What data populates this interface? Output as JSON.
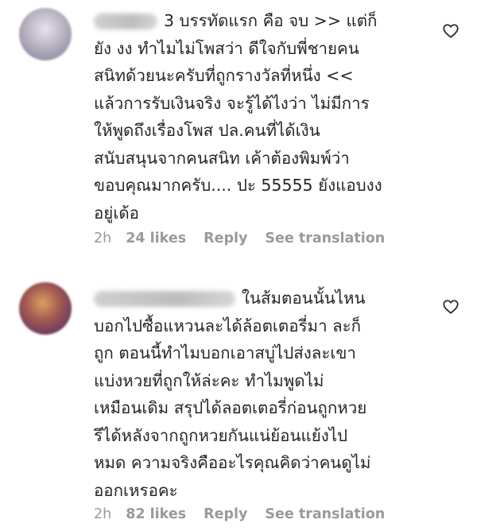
{
  "comments": [
    {
      "text": "3 บรรทัดแรก คือ จบ >> แต่ก็\nยัง งง ทำไมไม่โพสว่า ดีใจกับพี่ชายคน\nสนิทด้วยนะครับที่ถูกรางวัลที่หนึ่ง <<\nแล้วการรับเงินจริง จะรู้ได้ไงว่า ไม่มีการ\nให้พูดถึงเรื่องโพส ปล.คนที่ได้เงิน\nสนับสนุนจากคนสนิท เค้าต้องพิมพ์ว่า\nขอบคุณมากครับ.... ปะ 55555 ยังแอบงง\nอยู่เด้อ",
      "time": "2h",
      "likes": "24 likes",
      "reply": "Reply",
      "translate": "See translation",
      "avatar_icon": "user-avatar-icon",
      "like_icon": "heart-icon"
    },
    {
      "text": "ในส้มตอนนั้นไหน\nบอกไปซื้อแหวนละได้ล้อตเตอรี่มา ละก็\nถูก ตอนนี้ทำไมบอกเอาสบู่ไปส่งละเขา\nแบ่งหวยที่ถูกให้ล่ะคะ ทำไมพูดไม่\nเหมือนเดิม สรุปได้ลอตเตอรี่ก่อนถูกหวย\nรึได้หลังจากถูกหวยกันแน่ย้อนแย้งไป\nหมด ความจริงคืออะไรคุณคิดว่าคนดูไม่\nออกเหรอคะ",
      "time": "2h",
      "likes": "82 likes",
      "reply": "Reply",
      "translate": "See translation",
      "avatar_icon": "user-avatar-icon",
      "like_icon": "heart-icon"
    }
  ]
}
